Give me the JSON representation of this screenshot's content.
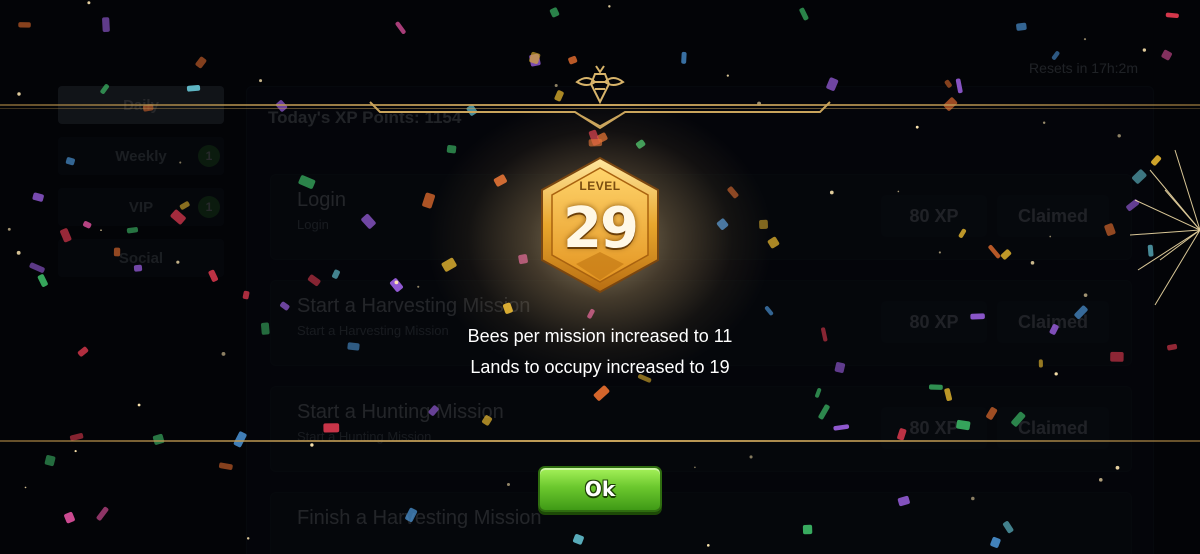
{
  "background": {
    "resets_text": "Resets in 17h:2m",
    "tabs": [
      {
        "label": "Daily",
        "active": true,
        "badge": ""
      },
      {
        "label": "Weekly",
        "active": false,
        "badge": "1"
      },
      {
        "label": "VIP",
        "active": false,
        "badge": "1"
      },
      {
        "label": "Social",
        "active": false,
        "badge": ""
      }
    ],
    "today_xp": "Today's XP Points: 1154",
    "missions": [
      {
        "title": "Login",
        "subtitle": "Login",
        "xp": "80 XP",
        "status": "Claimed"
      },
      {
        "title": "Start a Harvesting Mission",
        "subtitle": "Start a Harvesting Mission",
        "xp": "80 XP",
        "status": "Claimed"
      },
      {
        "title": "Start a Hunting Mission",
        "subtitle": "Start a Hunting Mission",
        "xp": "80 XP",
        "status": "Claimed"
      },
      {
        "title": "Finish a Harvesting Mission",
        "subtitle": "",
        "xp": "",
        "status": ""
      }
    ]
  },
  "level_up": {
    "level_label": "LEVEL",
    "level_number": "29",
    "rewards": [
      "Bees per mission increased to 11",
      "Lands to occupy increased to 19"
    ],
    "ok_label": "Ok"
  },
  "icons": {
    "emblem": "bee-icon",
    "badge": "hexagon-level-badge"
  },
  "colors": {
    "gold": "#c9a45c",
    "ok_green": "#6cc82e",
    "background": "#05070c"
  }
}
